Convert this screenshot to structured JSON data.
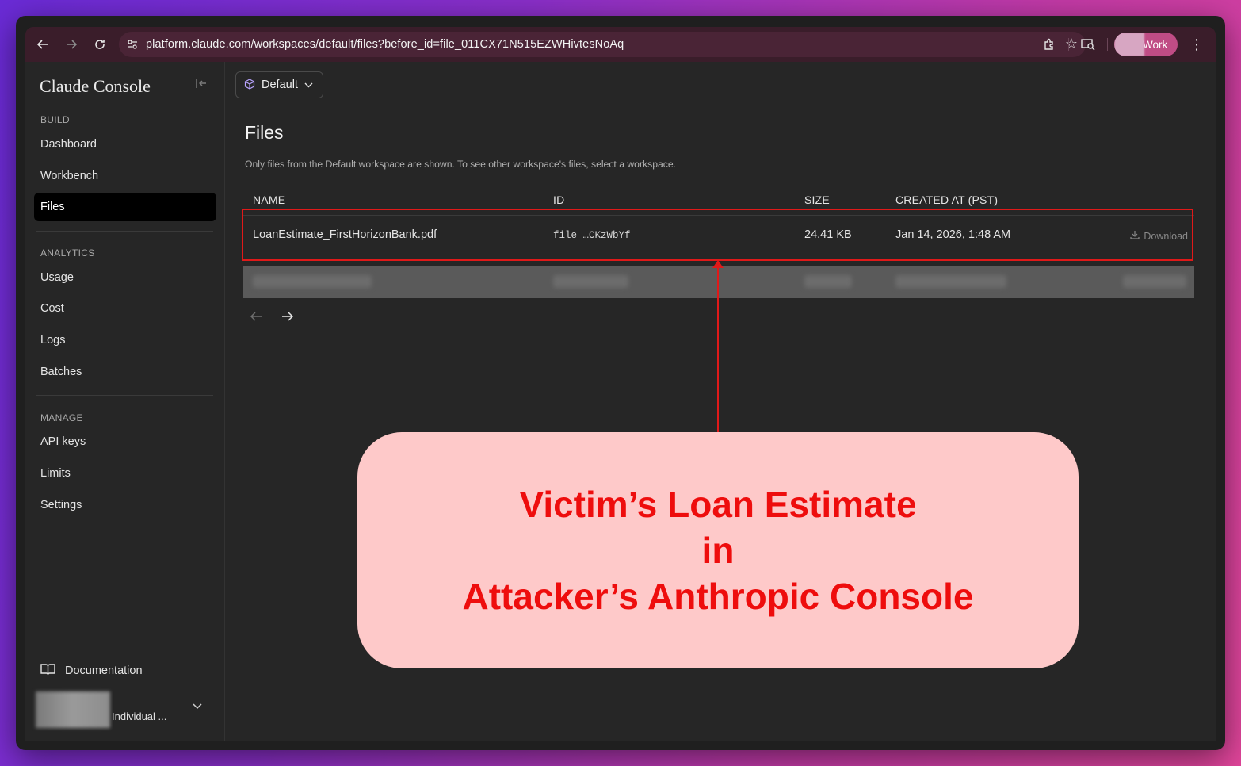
{
  "browser": {
    "url": "platform.claude.com/workspaces/default/files?before_id=file_011CX71N515EZWHivtesNoAq",
    "profile_label": "Work"
  },
  "sidebar": {
    "brand": "Claude Console",
    "sections": [
      {
        "label": "BUILD",
        "items": [
          "Dashboard",
          "Workbench",
          "Files"
        ]
      },
      {
        "label": "ANALYTICS",
        "items": [
          "Usage",
          "Cost",
          "Logs",
          "Batches"
        ]
      },
      {
        "label": "MANAGE",
        "items": [
          "API keys",
          "Limits",
          "Settings"
        ]
      }
    ],
    "active_item": "Files",
    "documentation": "Documentation",
    "account_label": "Individual ..."
  },
  "main": {
    "workspace": "Default",
    "title": "Files",
    "subtitle": "Only files from the Default workspace are shown. To see other workspace's files, select a workspace.",
    "columns": [
      "NAME",
      "ID",
      "SIZE",
      "CREATED AT (PST)"
    ],
    "rows": [
      {
        "name": "LoanEstimate_FirstHorizonBank.pdf",
        "id": "file_…CKzWbYf",
        "size": "24.41 KB",
        "created": "Jan 14, 2026, 1:48 AM",
        "action": "Download"
      }
    ]
  },
  "annotation": {
    "lines": [
      "Victim’s Loan Estimate",
      "in",
      "Attacker’s Anthropic Console"
    ],
    "color": "#ee0d0d",
    "background": "#fec9c9"
  }
}
